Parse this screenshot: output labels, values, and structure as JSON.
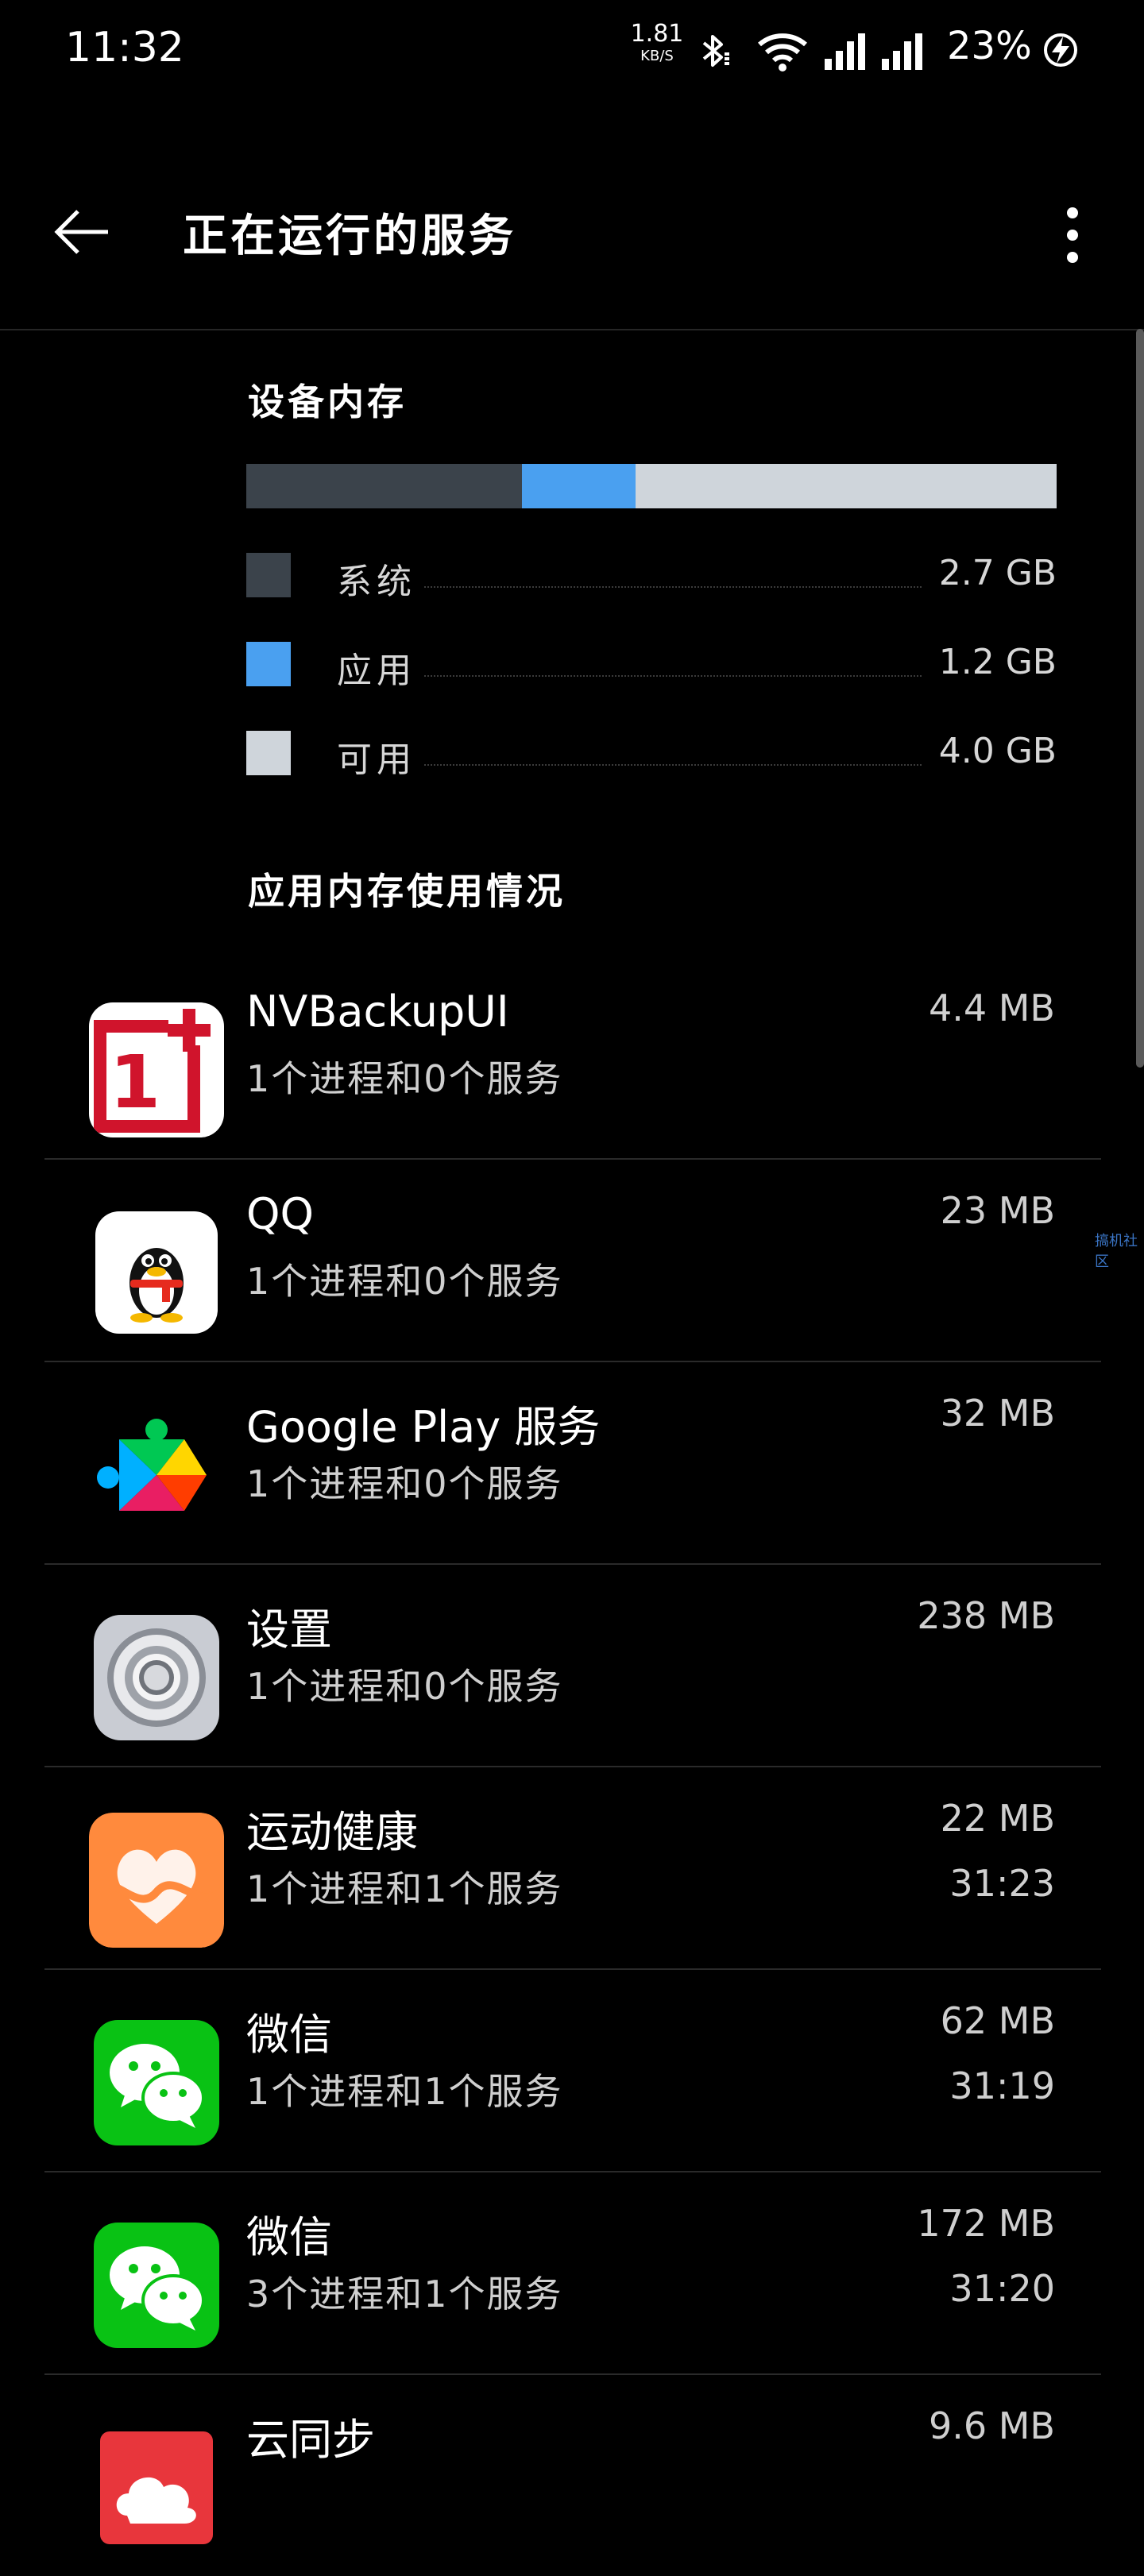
{
  "status_bar": {
    "time": "11:32",
    "net_speed_value": "1.81",
    "net_speed_unit": "KB/S",
    "icons": [
      "bluetooth-icon",
      "wifi-icon",
      "signal-icon",
      "signal-icon",
      "battery-charging-icon"
    ],
    "battery": "23%"
  },
  "app_bar": {
    "title": "正在运行的服务",
    "back_icon": "back-arrow-icon",
    "menu_icon": "more-vert-icon"
  },
  "device_memory": {
    "title": "设备内存",
    "bar": [
      {
        "key": "system",
        "fraction": 0.34,
        "color": "#3b434b"
      },
      {
        "key": "apps",
        "fraction": 0.14,
        "color": "#4aa0f0"
      },
      {
        "key": "free",
        "fraction": 0.52,
        "color": "#cfd5db"
      }
    ],
    "legend": [
      {
        "label": "系统",
        "value": "2.7 GB",
        "color": "#3b434b"
      },
      {
        "label": "应用",
        "value": "1.2 GB",
        "color": "#4aa0f0"
      },
      {
        "label": "可用",
        "value": "4.0 GB",
        "color": "#cfd5db"
      }
    ]
  },
  "app_memory": {
    "title": "应用内存使用情况",
    "apps": [
      {
        "name": "NVBackupUI",
        "detail": "1个进程和0个服务",
        "size": "4.4 MB",
        "time": "",
        "icon": "oneplus-logo-icon"
      },
      {
        "name": "QQ",
        "detail": "1个进程和0个服务",
        "size": "23 MB",
        "time": "",
        "icon": "qq-penguin-icon"
      },
      {
        "name": "Google Play 服务",
        "detail": "1个进程和0个服务",
        "size": "32 MB",
        "time": "",
        "icon": "google-play-services-icon"
      },
      {
        "name": "设置",
        "detail": "1个进程和0个服务",
        "size": "238 MB",
        "time": "",
        "icon": "settings-gear-icon"
      },
      {
        "name": "运动健康",
        "detail": "1个进程和1个服务",
        "size": "22 MB",
        "time": "31:23",
        "icon": "health-heart-icon"
      },
      {
        "name": "微信",
        "detail": "1个进程和1个服务",
        "size": "62 MB",
        "time": "31:19",
        "icon": "wechat-icon"
      },
      {
        "name": "微信",
        "detail": "3个进程和1个服务",
        "size": "172 MB",
        "time": "31:20",
        "icon": "wechat-icon"
      },
      {
        "name": "云同步",
        "detail": "",
        "size": "9.6 MB",
        "time": "",
        "icon": "cloud-sync-icon"
      }
    ]
  },
  "watermark": "搞机社区"
}
